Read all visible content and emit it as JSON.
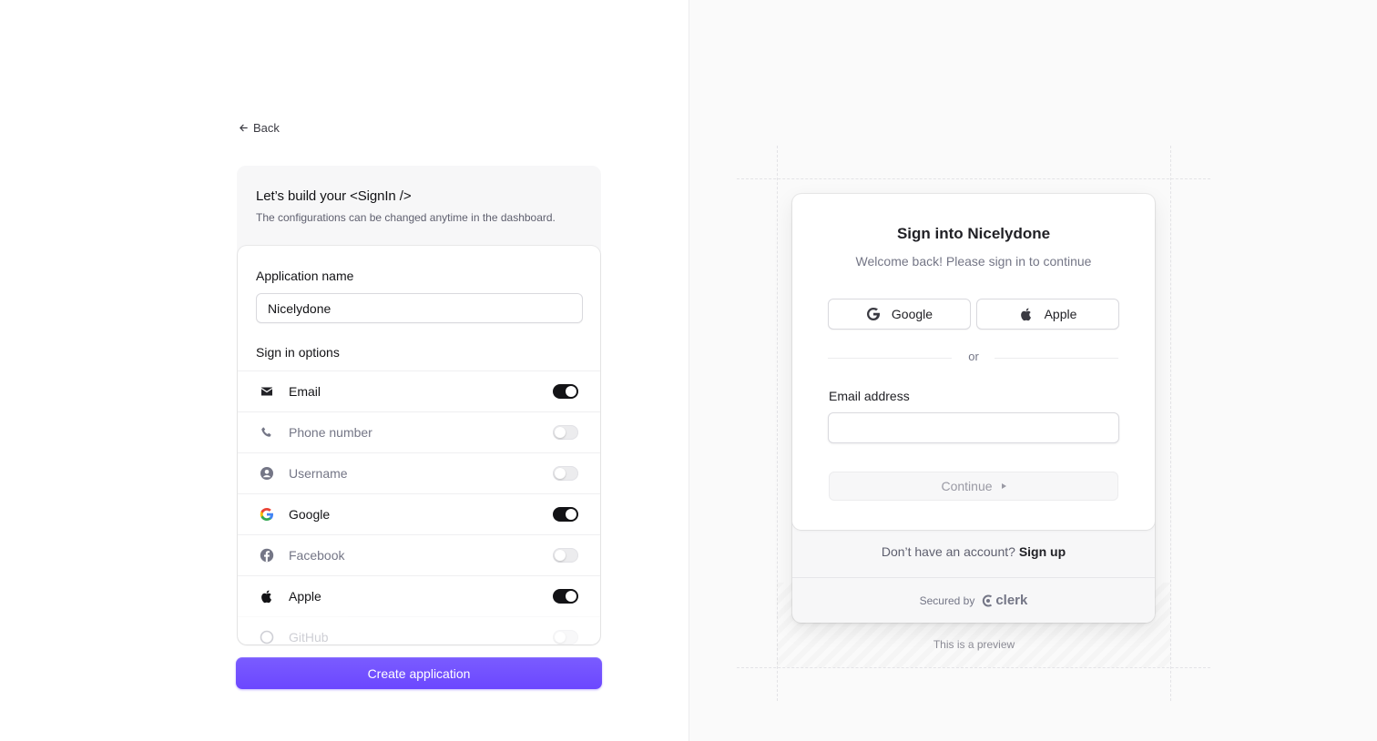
{
  "builder": {
    "back_label": "Back",
    "title": "Let’s build your <SignIn />",
    "subtitle": "The configurations can be changed anytime in the dashboard.",
    "app_name_label": "Application name",
    "app_name_value": "Nicelydone",
    "sign_in_options_label": "Sign in options",
    "options": [
      {
        "label": "Email",
        "icon": "mail-icon",
        "enabled": true
      },
      {
        "label": "Phone number",
        "icon": "phone-icon",
        "enabled": false
      },
      {
        "label": "Username",
        "icon": "user-circle-icon",
        "enabled": false
      },
      {
        "label": "Google",
        "icon": "google-icon",
        "enabled": true
      },
      {
        "label": "Facebook",
        "icon": "facebook-icon",
        "enabled": false
      },
      {
        "label": "Apple",
        "icon": "apple-icon",
        "enabled": true
      },
      {
        "label": "GitHub",
        "icon": "github-icon",
        "enabled": false
      }
    ],
    "create_button_label": "Create application",
    "accent_color": "#6c47ff"
  },
  "preview": {
    "title": "Sign into Nicelydone",
    "subtitle": "Welcome back! Please sign in to continue",
    "social_buttons": [
      {
        "label": "Google",
        "icon": "google-icon"
      },
      {
        "label": "Apple",
        "icon": "apple-icon"
      }
    ],
    "divider_text": "or",
    "email_label": "Email address",
    "email_value": "",
    "continue_label": "Continue",
    "no_account_text": "Don’t have an account?",
    "sign_up_label": "Sign up",
    "secured_by": "Secured by",
    "brand_name": "clerk",
    "preview_note": "This is a preview"
  }
}
